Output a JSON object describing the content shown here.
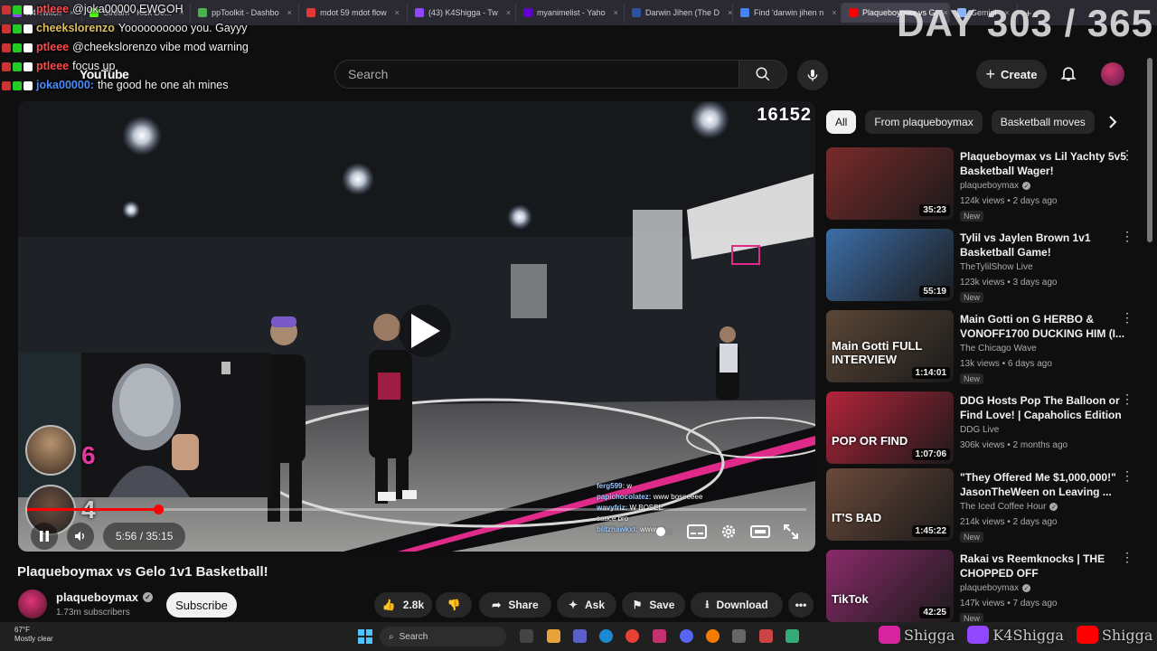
{
  "browser": {
    "tabs": [
      {
        "label": "K4 Twitch",
        "color": "#9146ff"
      },
      {
        "label": "Stream - Kick De...",
        "color": "#53fc18"
      },
      {
        "label": "ppToolkit - Dashbo",
        "color": "#4caf50"
      },
      {
        "label": "mdot 59 mdot flow",
        "color": "#e53935"
      },
      {
        "label": "(43) K4Shigga - Tw",
        "color": "#9146ff"
      },
      {
        "label": "myanimelist - Yaho",
        "color": "#6001d2"
      },
      {
        "label": "Darwin Jihen (The D",
        "color": "#2e51a2"
      },
      {
        "label": "Find 'darwin jihen n",
        "color": "#4285f4"
      },
      {
        "label": "Plaqueboymax vs G",
        "color": "#ff0000"
      },
      {
        "label": "Gemini",
        "color": "#8ab4f8"
      }
    ],
    "active_tab": 8
  },
  "stream_overlay": {
    "day_counter": "DAY 303 / 365",
    "chat": [
      {
        "user": "ptleee",
        "message": "@joka00000 EWGOH",
        "color": "#ff4b4b"
      },
      {
        "user": "cheekslorenzo",
        "message": "Yoooooooooo you. Gayyy",
        "color": "#e0c060"
      },
      {
        "user": "ptleee",
        "message": "@cheekslorenzo vibe mod warning",
        "color": "#ff4b4b"
      },
      {
        "user": "ptleee",
        "message": "focus up",
        "color": "#ff4b4b"
      },
      {
        "user": "joka00000:",
        "message": "the good he one ah mines",
        "color": "#4a8cff"
      }
    ],
    "score_top": "6",
    "score_bottom": "4",
    "video_chat": [
      {
        "user": "ferg599:",
        "message": "w"
      },
      {
        "user": "papichocolatez:",
        "message": "www boseeeee"
      },
      {
        "user": "wavyfriz:",
        "message": "W BOSEE"
      },
      {
        "user": "",
        "message": "sauce bro"
      },
      {
        "user": "blitzhawkxt:",
        "message": "wwwww"
      }
    ],
    "socials": [
      {
        "handle": "Shigga",
        "color": "#d6249f"
      },
      {
        "handle": "K4Shigga",
        "color": "#9146ff"
      },
      {
        "handle": "Shigga",
        "color": "#ff0000"
      }
    ]
  },
  "youtube": {
    "logo": "YouTube",
    "search_placeholder": "Search",
    "create_label": "Create",
    "player": {
      "timestamp_overlay": "16152",
      "time": "5:56 / 35:15",
      "progress": 0.168
    },
    "video": {
      "title": "Plaqueboymax vs Gelo 1v1 Basketball!",
      "channel": "plaqueboymax",
      "subscribers": "1.73m subscribers",
      "subscribe_label": "Subscribe",
      "likes": "2.8k",
      "share_label": "Share",
      "ask_label": "Ask",
      "save_label": "Save",
      "download_label": "Download"
    },
    "chips": [
      "All",
      "From plaqueboymax",
      "Basketball moves"
    ],
    "recommendations": [
      {
        "title": "Plaqueboymax vs Lil Yachty 5v5 Basketball Wager!",
        "channel": "plaqueboymax",
        "verified": true,
        "meta": "124k views • 2 days ago",
        "badge": "New",
        "duration": "35:23",
        "thumb": "#7a2a2a"
      },
      {
        "title": "Tylil vs Jaylen Brown 1v1 Basketball Game!",
        "channel": "TheTylilShow Live",
        "verified": false,
        "meta": "123k views • 3 days ago",
        "badge": "New",
        "duration": "55:19",
        "thumb": "#3d6ea8"
      },
      {
        "title": "Main Gotti on G HERBO & VONOFF1700 DUCKING HIM (I...",
        "channel": "The Chicago Wave",
        "verified": false,
        "meta": "13k views • 6 days ago",
        "badge": "New",
        "duration": "1:14:01",
        "thumb": "#5a4636",
        "thumb_text": "Main Gotti FULL INTERVIEW"
      },
      {
        "title": "DDG Hosts Pop The Balloon or Find Love! | Capaholics Edition",
        "channel": "DDG Live",
        "verified": false,
        "meta": "306k views • 2 months ago",
        "badge": "",
        "duration": "1:07:06",
        "thumb": "#b3233a",
        "thumb_text": "POP OR FIND"
      },
      {
        "title": "\"They Offered Me $1,000,000!\" JasonTheWeen on Leaving ...",
        "channel": "The Iced Coffee Hour",
        "verified": true,
        "meta": "214k views • 2 days ago",
        "badge": "New",
        "duration": "1:45:22",
        "thumb": "#6b4a3a",
        "thumb_text": "IT'S BAD"
      },
      {
        "title": "Rakai vs Reemknocks | THE CHOPPED OFF",
        "channel": "plaqueboymax",
        "verified": true,
        "meta": "147k views • 7 days ago",
        "badge": "New",
        "duration": "42:25",
        "thumb": "#8a2a6a",
        "thumb_text": "TikTok"
      }
    ]
  },
  "taskbar": {
    "weather_temp": "67°F",
    "weather_desc": "Mostly clear",
    "search_label": "Search"
  }
}
